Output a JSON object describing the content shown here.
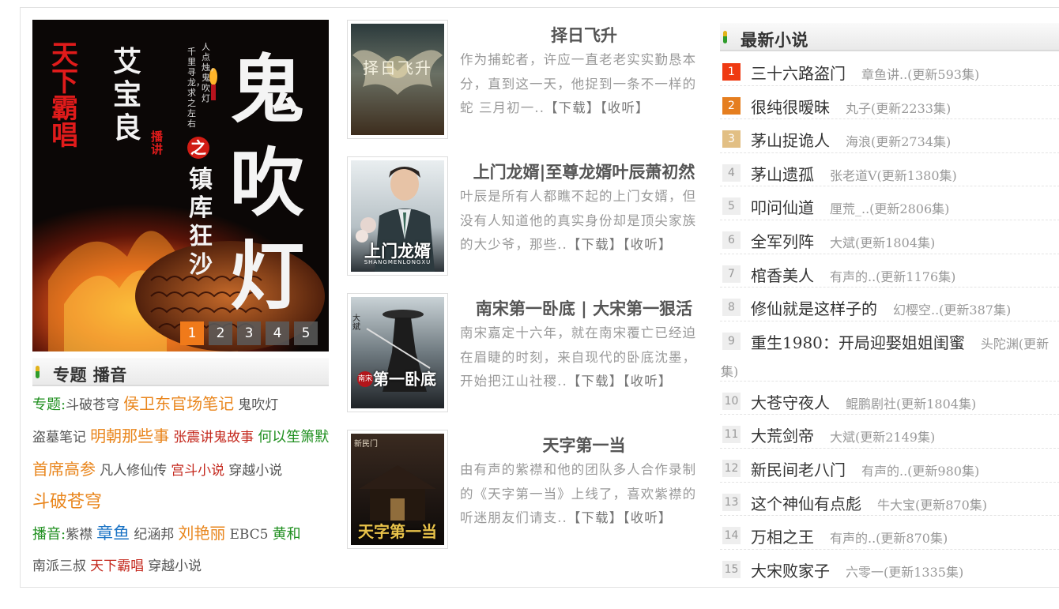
{
  "hero": {
    "pages": [
      "1",
      "2",
      "3",
      "4",
      "5"
    ],
    "active_page": "1",
    "cover_text": {
      "narrator": "天下霸唱",
      "author": "艾宝良",
      "bozhu": "播讲",
      "tagline_1": "人点烛，鬼吹灯",
      "tagline_2": "千里寻龙，求之左右",
      "series": "鬼吹灯",
      "zhi": "之",
      "subtitle": "镇库狂沙"
    }
  },
  "topics": {
    "header": "专题 播音",
    "line_topics_label": "专题:",
    "topics": [
      {
        "text": "斗破苍穹",
        "style": "d"
      },
      {
        "text": "侯卫东官场笔记",
        "style": "o"
      },
      {
        "text": "鬼吹灯",
        "style": "d"
      },
      {
        "text": "盗墓笔记",
        "style": "d"
      },
      {
        "text": "明朝那些事",
        "style": "o"
      },
      {
        "text": "张震讲鬼故事",
        "style": "r"
      },
      {
        "text": "何以笙箫默",
        "style": "g"
      },
      {
        "text": "首席高参",
        "style": "o"
      },
      {
        "text": "凡人修仙传",
        "style": "d"
      },
      {
        "text": "宫斗小说",
        "style": "r"
      },
      {
        "text": "穿越小说",
        "style": "d"
      },
      {
        "text": "斗破苍穹",
        "style": "ol"
      }
    ],
    "line_broadcast_label": "播音:",
    "broadcasters": [
      {
        "text": "紫襟",
        "style": "d"
      },
      {
        "text": "章鱼",
        "style": "b"
      },
      {
        "text": "纪涵邦",
        "style": "d"
      },
      {
        "text": "刘艳丽",
        "style": "o"
      },
      {
        "text": "EBC5",
        "style": "d"
      },
      {
        "text": "黄和",
        "style": "g"
      },
      {
        "text": "南派三叔",
        "style": "d"
      },
      {
        "text": "天下霸唱",
        "style": "r"
      },
      {
        "text": "穿越小说",
        "style": "d"
      }
    ]
  },
  "features": [
    {
      "title": "择日飞升",
      "desc": "作为捕蛇者，许应一直老老实实勤恳本分，直到这一天，他捉到一条不一样的蛇 三月初一..",
      "download": "【下载】",
      "listen": "【收听】",
      "cover_text": "择日飞升"
    },
    {
      "title": "上门龙婿|至尊龙婿叶辰萧初然",
      "desc": "叶辰是所有人都瞧不起的上门女婿，但没有人知道他的真实身份却是顶尖家族的大少爷，那些..",
      "download": "【下载】",
      "listen": "【收听】",
      "cover_text": "上门龙婿",
      "cover_sub": "SHANGMENLONGXU"
    },
    {
      "title": "南宋第一卧底 | 大宋第一狠活",
      "desc": "南宋嘉定十六年，就在南宋覆亡已经迫在眉睫的时刻，来自现代的卧底沈墨，开始把江山社稷..",
      "download": "【下载】",
      "listen": "【收听】",
      "cover_text": "第一卧底",
      "cover_tag": "南宋",
      "cover_author": "大斌"
    },
    {
      "title": "天字第一当",
      "desc": "由有声的紫襟和他的团队多人合作录制的《天字第一当》上线了，喜欢紫襟的听迷朋友们请支..",
      "download": "【下载】",
      "listen": "【收听】",
      "cover_text": "天字第一当",
      "cover_tag": "新民门"
    }
  ],
  "latest": {
    "header": "最新小说",
    "items": [
      {
        "rank": "1",
        "name": "三十六路盗门",
        "meta": "章鱼讲..(更新593集)"
      },
      {
        "rank": "2",
        "name": "很纯很暧昧",
        "meta": "丸子(更新2233集)"
      },
      {
        "rank": "3",
        "name": "茅山捉诡人",
        "meta": "海浪(更新2734集)"
      },
      {
        "rank": "4",
        "name": "茅山遗孤",
        "meta": "张老道V(更新1380集)"
      },
      {
        "rank": "5",
        "name": "叩问仙道",
        "meta": "厘荒_..(更新2806集)"
      },
      {
        "rank": "6",
        "name": "全军列阵",
        "meta": "大斌(更新1804集)"
      },
      {
        "rank": "7",
        "name": "棺香美人",
        "meta": "有声的..(更新1176集)"
      },
      {
        "rank": "8",
        "name": "修仙就是这样子的",
        "meta": "幻樱空..(更新387集)"
      },
      {
        "rank": "9",
        "name": "重生1980：开局迎娶姐姐闺蜜",
        "meta": "头陀渊(更新",
        "meta_wrap": "集)"
      },
      {
        "rank": "10",
        "name": "大苍守夜人",
        "meta": "鲲鹏剧社(更新1804集)"
      },
      {
        "rank": "11",
        "name": "大荒剑帝",
        "meta": "大斌(更新2149集)"
      },
      {
        "rank": "12",
        "name": "新民间老八门",
        "meta": "有声的..(更新980集)"
      },
      {
        "rank": "13",
        "name": "这个神仙有点彪",
        "meta": "牛大宝(更新870集)"
      },
      {
        "rank": "14",
        "name": "万相之王",
        "meta": "有声的..(更新870集)"
      },
      {
        "rank": "15",
        "name": "大宋败家子",
        "meta": "六零一(更新1335集)"
      }
    ]
  },
  "colors": {
    "accent_orange": "#f07a1a",
    "tag_green": "#1f8f1f",
    "tag_red": "#c4291e",
    "tag_blue": "#1b73c5",
    "rank1": "#ef3a12",
    "rank2": "#e57e1f",
    "rank3": "#e2bf84"
  }
}
